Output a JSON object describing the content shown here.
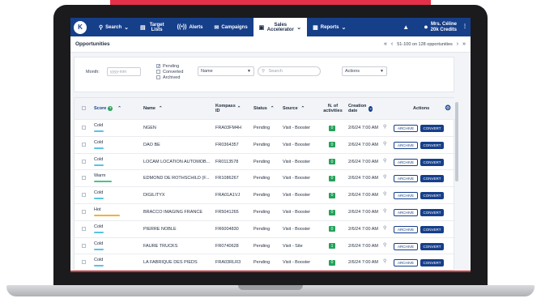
{
  "nav": {
    "logo": "K",
    "items": [
      {
        "label": "Search",
        "icon": "search-icon"
      },
      {
        "label": "Target Lists",
        "icon": "list-icon"
      },
      {
        "label": "Alerts",
        "icon": "radio-icon"
      },
      {
        "label": "Campaigns",
        "icon": "mail-icon"
      },
      {
        "label": "Sales Accelerator",
        "icon": "gauge-icon"
      },
      {
        "label": "Reports",
        "icon": "report-icon"
      }
    ],
    "user_name": "Mrs. Céline",
    "credits": "20k Credits"
  },
  "page": {
    "title": "Opportunities",
    "pager_text": "51-100 on 128 opportunities"
  },
  "filters": {
    "month_label": "Month:",
    "month_placeholder": "yyyy-mm",
    "statuses": [
      {
        "label": "Pending",
        "checked": true
      },
      {
        "label": "Converted",
        "checked": false
      },
      {
        "label": "Archived",
        "checked": false
      }
    ],
    "name_select": "Name",
    "search_placeholder": "Search",
    "actions_select": "Actions"
  },
  "table": {
    "headers": {
      "score": "Score",
      "name": "Name",
      "kompass_id": "Kompass ID",
      "status": "Status",
      "source": "Source",
      "activities": "N. of activities",
      "creation_date": "Creation date",
      "actions": "Actions"
    },
    "archive_label": "ARCHIVE",
    "convert_label": "CONVERT",
    "rows": [
      {
        "score": "Cold",
        "name": "NGEN",
        "kompass_id": "FRA03FM4H",
        "status": "Pending",
        "source": "Visit - Booster",
        "activities": "0",
        "date": "2/6/24 7:00 AM"
      },
      {
        "score": "Cold",
        "name": "DAO BE",
        "kompass_id": "FR0364357",
        "status": "Pending",
        "source": "Visit - Booster",
        "activities": "0",
        "date": "2/6/24 7:00 AM"
      },
      {
        "score": "Cold",
        "name": "LOCAM LOCATION AUTOMOB...",
        "kompass_id": "FR0113578",
        "status": "Pending",
        "source": "Visit - Booster",
        "activities": "0",
        "date": "2/6/24 7:00 AM"
      },
      {
        "score": "Warm",
        "name": "EDMOND DE ROTHSCHILD (F...",
        "kompass_id": "FR1086267",
        "status": "Pending",
        "source": "Visit - Booster",
        "activities": "0",
        "date": "2/6/24 7:00 AM"
      },
      {
        "score": "Cold",
        "name": "DIGILITYX",
        "kompass_id": "FRA01A1VJ",
        "status": "Pending",
        "source": "Visit - Booster",
        "activities": "0",
        "date": "2/6/24 7:00 AM"
      },
      {
        "score": "Hot",
        "name": "BRACCO IMAGING FRANCE",
        "kompass_id": "FR5041265",
        "status": "Pending",
        "source": "Visit - Booster",
        "activities": "0",
        "date": "2/6/24 7:00 AM"
      },
      {
        "score": "Cold",
        "name": "PIERRE NOBLE",
        "kompass_id": "FR6004830",
        "status": "Pending",
        "source": "Visit - Booster",
        "activities": "0",
        "date": "2/6/24 7:00 AM"
      },
      {
        "score": "Cold",
        "name": "FAURE TRUCKS",
        "kompass_id": "FR0740628",
        "status": "Pending",
        "source": "Visit - Site",
        "activities": "1",
        "date": "2/6/24 7:00 AM"
      },
      {
        "score": "Cold",
        "name": "LA FABRIQUE DES PIEDS",
        "kompass_id": "FRA03RLR3",
        "status": "Pending",
        "source": "Visit - Booster",
        "activities": "0",
        "date": "2/6/24 7:00 AM"
      }
    ]
  },
  "colors": {
    "primary": "#163f8a",
    "cold": "#59c3e3",
    "warm": "#4cc28a",
    "hot": "#f2b233",
    "activity": "#25a15a"
  }
}
